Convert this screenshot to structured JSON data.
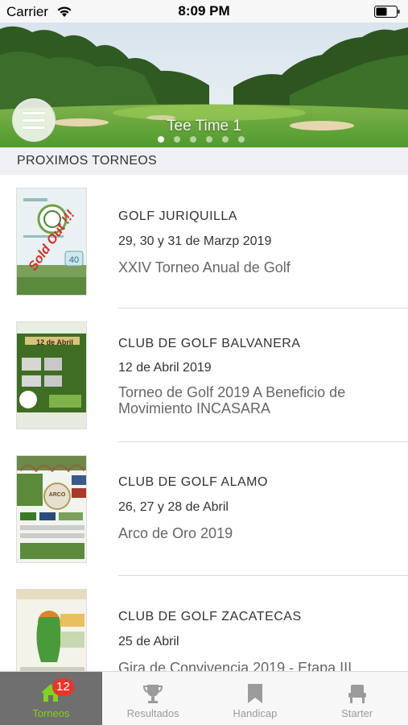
{
  "status_bar": {
    "carrier": "Carrier",
    "time": "8:09 PM"
  },
  "hero": {
    "caption": "Tee Time 1",
    "page_count": 6,
    "active_page": 1
  },
  "section": {
    "title": "PROXIMOS TORNEOS"
  },
  "tournaments": [
    {
      "club": "GOLF JURIQUILLA",
      "date": "29, 30 y 31 de Marzp 2019",
      "name": "XXIV Torneo Anual de Golf",
      "poster_text": "Sold Out !!!"
    },
    {
      "club": "CLUB DE GOLF BALVANERA",
      "date": "12 de Abril 2019",
      "name": "Torneo de Golf 2019 A Beneficio de Movimiento INCASARA",
      "poster_text": "12 de Abril"
    },
    {
      "club": "CLUB DE GOLF ALAMO",
      "date": "26, 27 y 28 de Abril",
      "name": "Arco de Oro 2019",
      "poster_text": "ARCO"
    },
    {
      "club": "CLUB DE GOLF ZACATECAS",
      "date": "25 de Abril",
      "name": "Gira de Convivencia 2019 - Etapa III",
      "poster_text": ""
    }
  ],
  "tabs": [
    {
      "label": "Torneos",
      "icon": "home-icon",
      "badge": "12",
      "active": true
    },
    {
      "label": "Resultados",
      "icon": "trophy-icon",
      "active": false
    },
    {
      "label": "Handicap",
      "icon": "bookmark-icon",
      "active": false
    },
    {
      "label": "Starter",
      "icon": "chair-icon",
      "active": false
    }
  ],
  "colors": {
    "active_tab_bg": "#6f6f6f",
    "active_tab_label": "#7ed321",
    "badge": "#e8362b",
    "section_bg": "#efeff4"
  }
}
